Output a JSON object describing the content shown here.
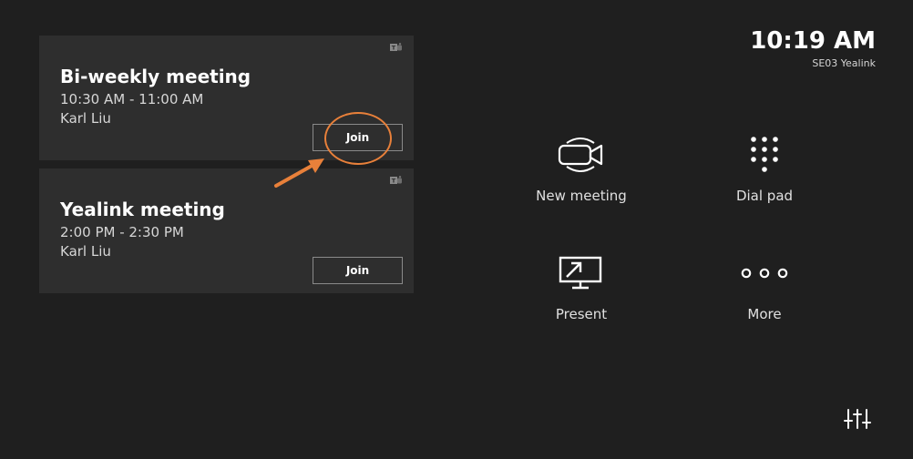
{
  "meetings": [
    {
      "title": "Bi-weekly meeting",
      "time": "10:30 AM - 11:00 AM",
      "organizer": "Karl Liu",
      "join_label": "Join",
      "icon": "teams-icon"
    },
    {
      "title": "Yealink meeting",
      "time": "2:00 PM - 2:30 PM",
      "organizer": "Karl Liu",
      "join_label": "Join",
      "icon": "teams-icon"
    }
  ],
  "clock": {
    "time": "10:19 AM",
    "room": "SE03 Yealink"
  },
  "actions": [
    {
      "label": "New meeting",
      "icon": "video-camera-icon"
    },
    {
      "label": "Dial pad",
      "icon": "dial-pad-icon"
    },
    {
      "label": "Present",
      "icon": "present-screen-icon"
    },
    {
      "label": "More",
      "icon": "more-dots-icon"
    }
  ],
  "settings": {
    "icon": "settings-sliders-icon"
  },
  "annotation": {
    "color": "#e8803a",
    "shapes": [
      "circle",
      "arrow"
    ]
  },
  "colors": {
    "background": "#1f1f1f",
    "card": "#2e2e2e",
    "accent": "#e8803a"
  }
}
